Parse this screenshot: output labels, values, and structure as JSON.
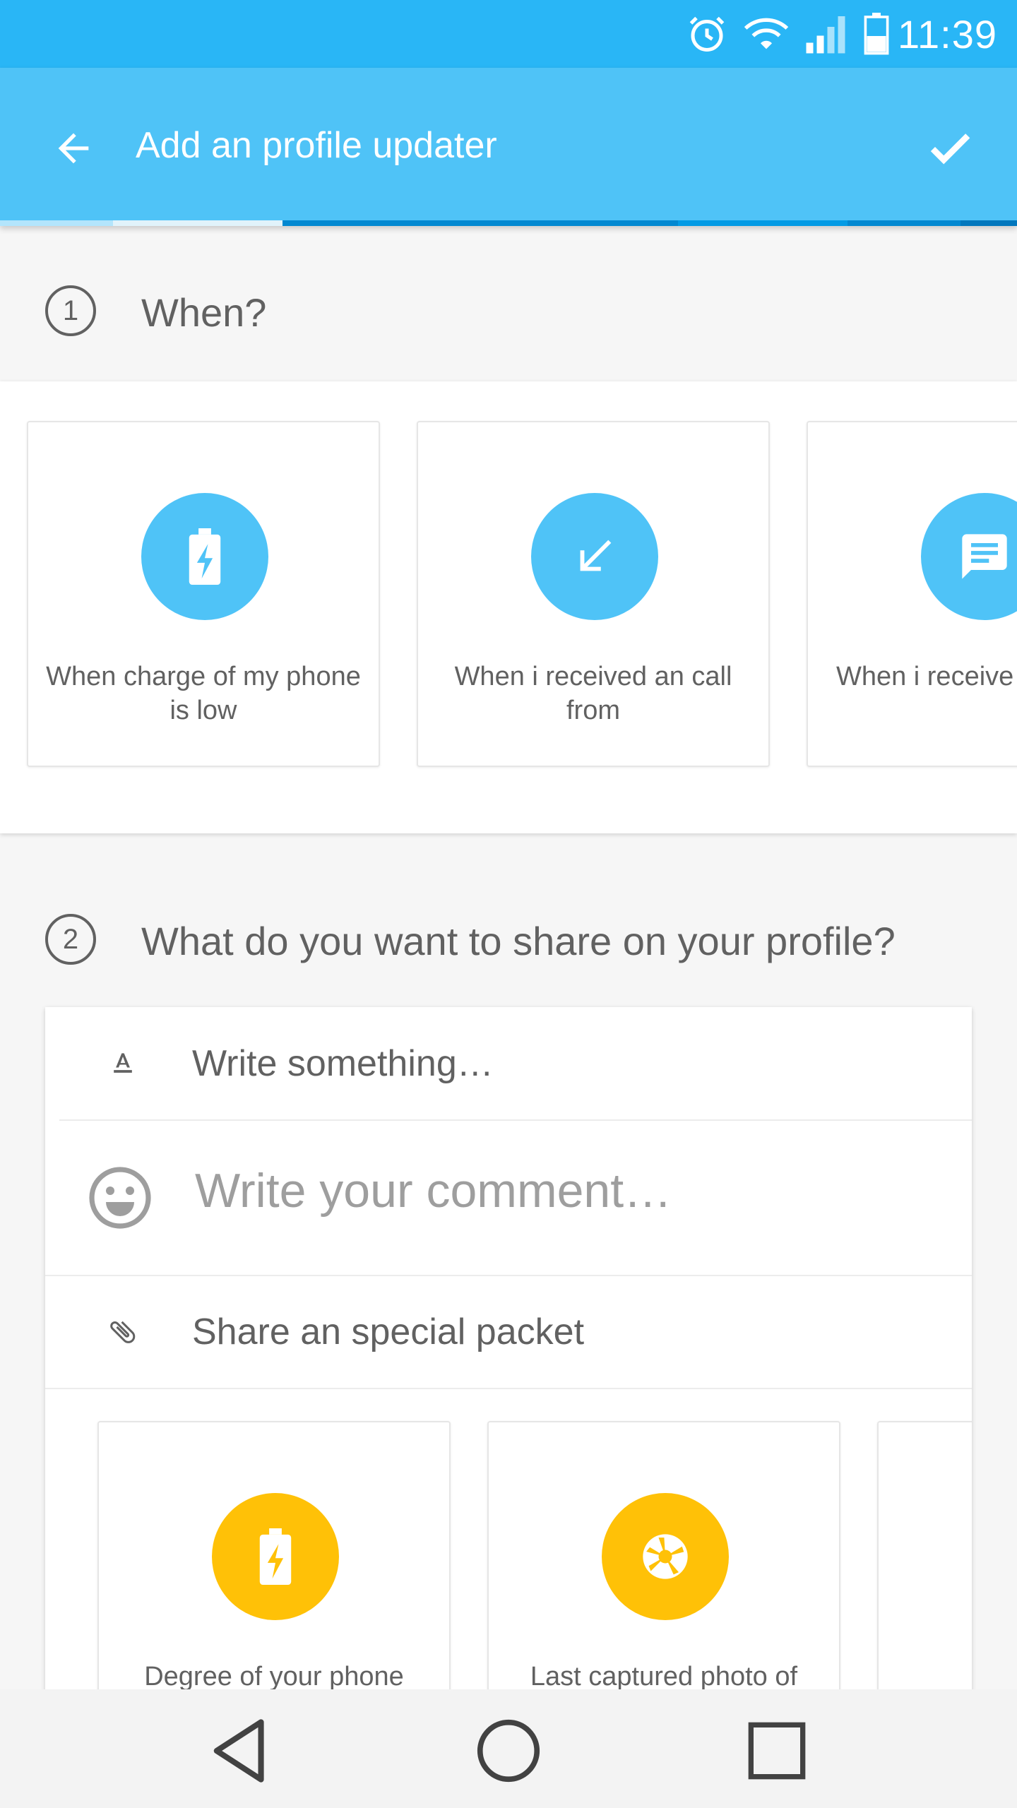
{
  "status_bar": {
    "time": "11:39",
    "icons": [
      "alarm-icon",
      "wifi-icon",
      "signal-icon",
      "battery-icon"
    ]
  },
  "toolbar": {
    "title": "Add an profile updater",
    "back_icon": "arrow-back-icon",
    "confirm_icon": "check-icon",
    "accent": "#4fc3f7",
    "status_color": "#29b6f6"
  },
  "section_when": {
    "number": "1",
    "title": "When?",
    "cards": [
      {
        "icon": "battery-charging-icon",
        "label": "When charge of my phone is low"
      },
      {
        "icon": "call-received-icon",
        "label": "When i received an call from"
      },
      {
        "icon": "message-icon",
        "label": "When i receive message"
      }
    ],
    "icon_color": "#4fc3f7"
  },
  "section_share": {
    "number": "2",
    "title": "What do you want to share on your profile?",
    "write_label": "Write something…",
    "comment_placeholder": "Write your comment…",
    "packet_label": "Share an special packet",
    "packets": [
      {
        "icon": "battery-charging-icon",
        "label": "Degree of your phone"
      },
      {
        "icon": "camera-shutter-icon",
        "label": "Last captured photo of"
      },
      {
        "icon": "",
        "label": ""
      }
    ],
    "packet_color": "#ffc107"
  },
  "nav_bar": {
    "buttons": [
      "back-triangle-icon",
      "home-circle-icon",
      "recents-square-icon"
    ]
  }
}
